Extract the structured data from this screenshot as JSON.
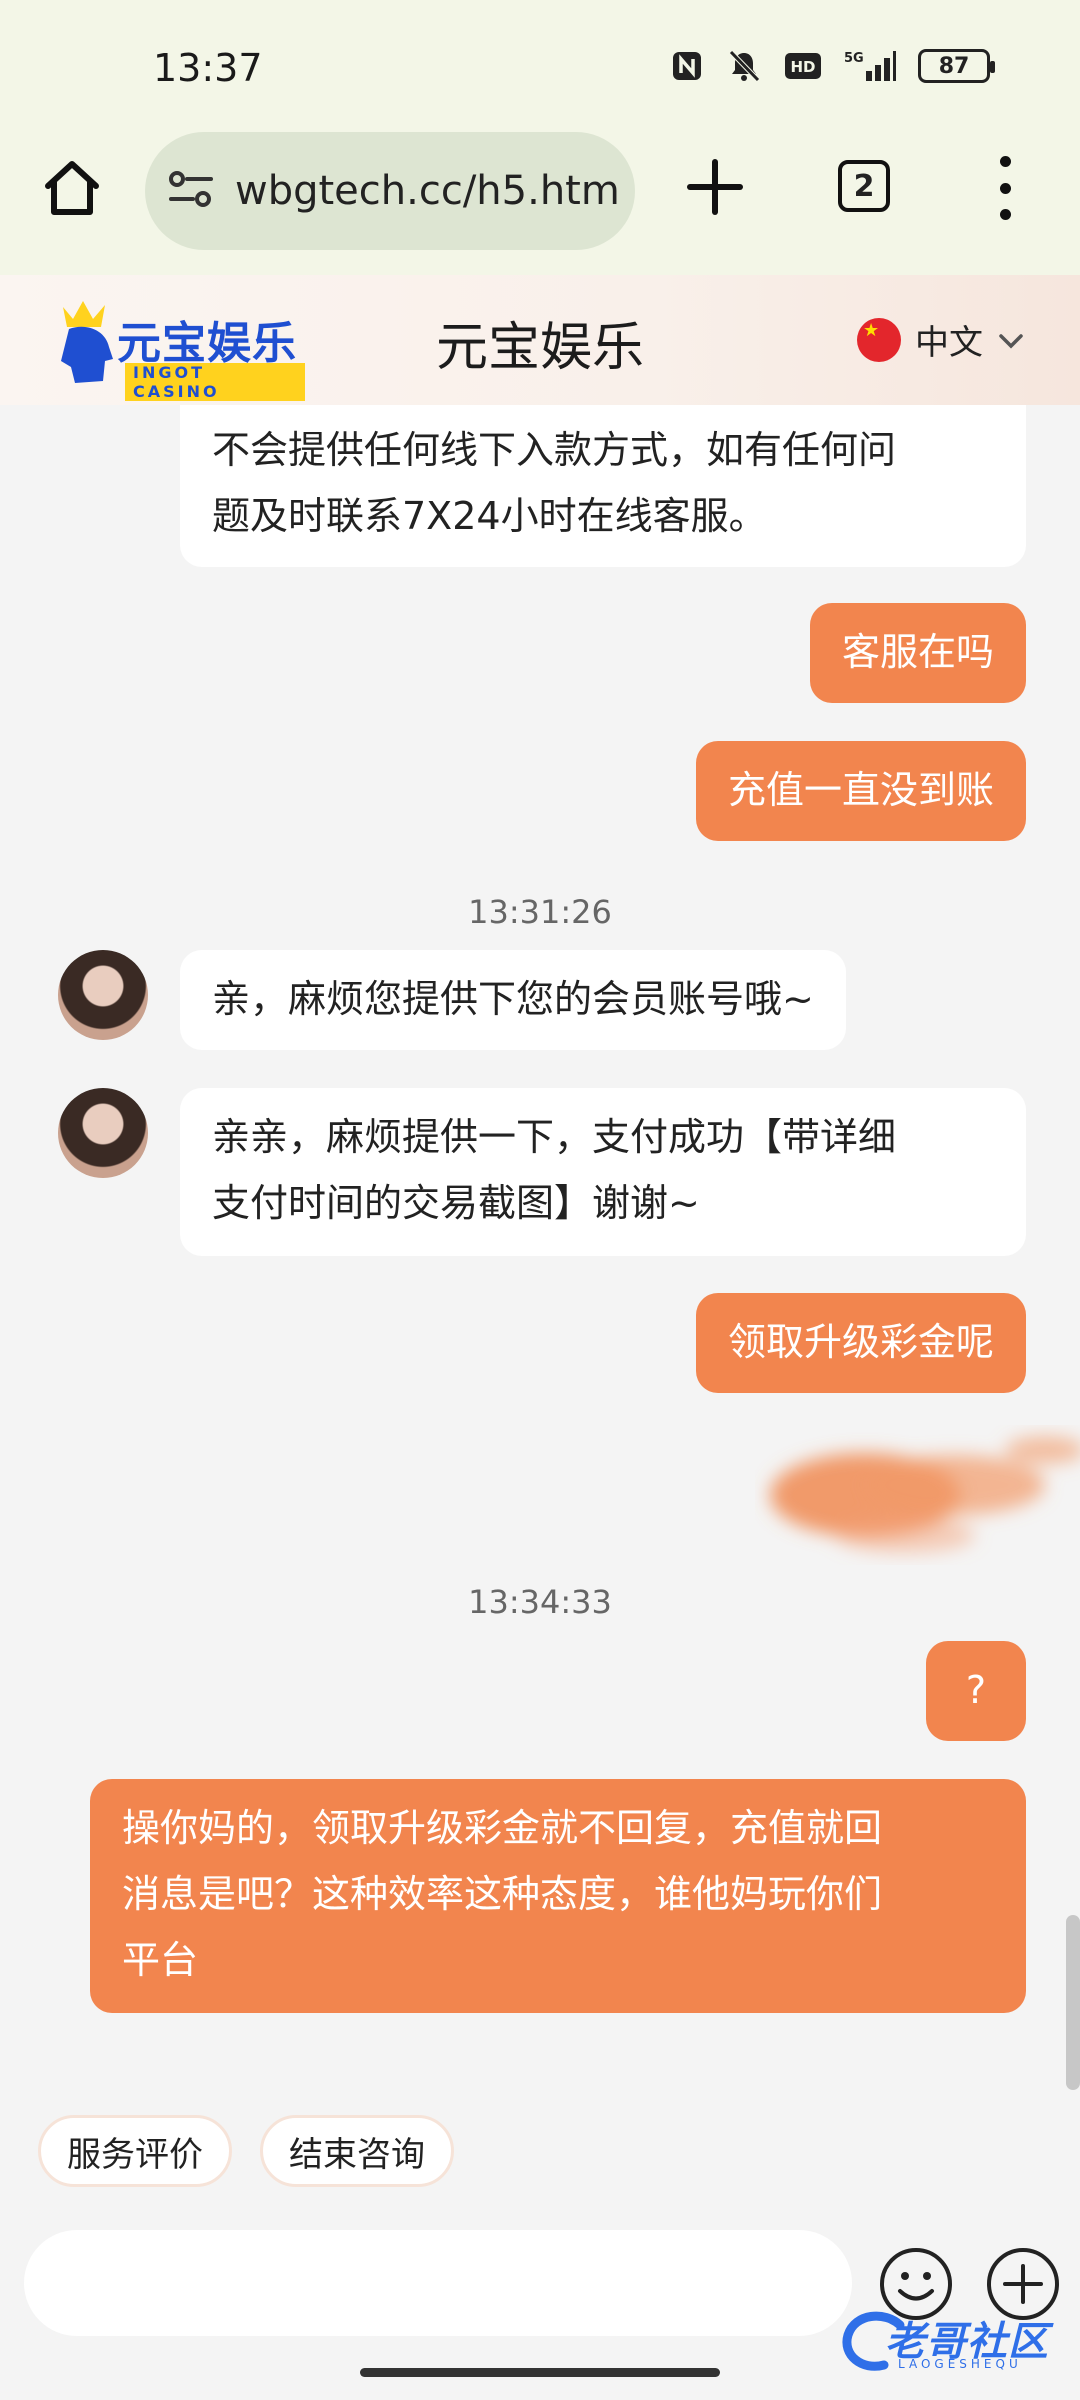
{
  "status_bar": {
    "time": "13:37",
    "icons": [
      "nfc-icon",
      "mute-icon",
      "hd-icon",
      "5g-signal-icon"
    ],
    "battery": "87"
  },
  "browser": {
    "url": "wbgtech.cc/h5.htm",
    "tab_count": "2"
  },
  "header": {
    "logo_text": "元宝娱乐",
    "logo_sub": "INGOT CASINO",
    "title": "元宝娱乐",
    "language": "中文"
  },
  "messages": {
    "m1_line1": "不会提供任何线下入款方式，如有任何问",
    "m1_line2": "题及时联系7X24小时在线客服。",
    "m2": "客服在吗",
    "m3": "充值一直没到账",
    "ts1": "13:31:26",
    "m4": "亲，麻烦您提供下您的会员账号哦~",
    "m5_line1": "亲亲，麻烦提供一下，支付成功【带详细",
    "m5_line2": "支付时间的交易截图】谢谢~",
    "m6": "领取升级彩金呢",
    "ts2": "13:34:33",
    "m7": "?",
    "m8_line1": "操你妈的，领取升级彩金就不回复，充值就回",
    "m8_line2": "消息是吧？这种效率这种态度，谁他妈玩你们",
    "m8_line3": "平台"
  },
  "quick_actions": {
    "rate": "服务评价",
    "end": "结束咨询"
  },
  "watermark": {
    "text": "老哥社区",
    "sub": "LAOGESHEQU"
  },
  "colors": {
    "accent": "#f2854e",
    "browser_bg": "#f3f6e7",
    "chat_bg": "#f4f4f4"
  }
}
